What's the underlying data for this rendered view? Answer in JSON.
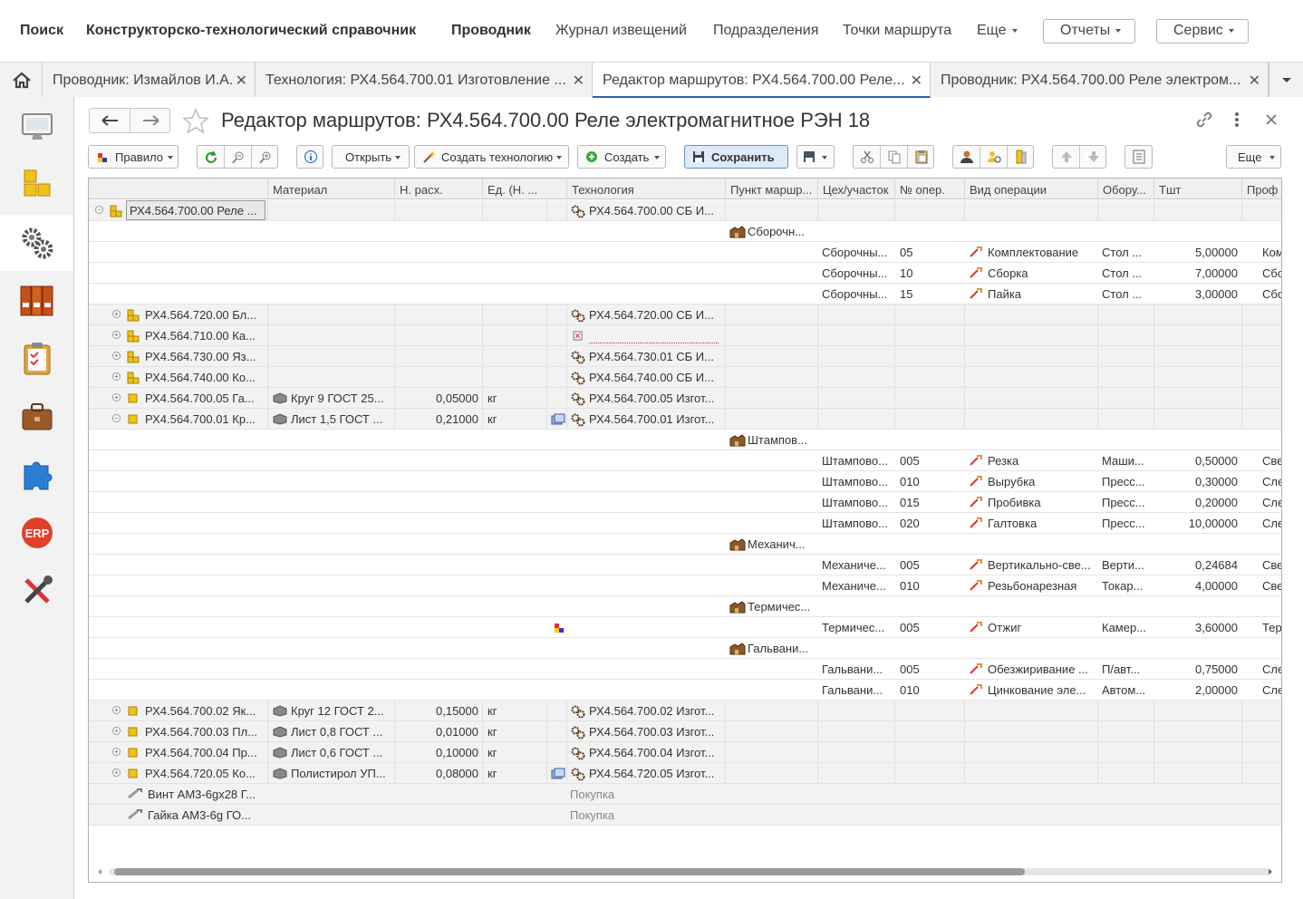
{
  "topnav": {
    "search": "Поиск",
    "reference": "Конструкторско-технологический справочник",
    "explorer": "Проводник",
    "journal": "Журнал извещений",
    "divisions": "Подразделения",
    "route_points": "Точки маршрута",
    "more": "Еще",
    "reports": "Отчеты",
    "service": "Сервис"
  },
  "tabs": [
    {
      "label": "Проводник: Измайлов И.А."
    },
    {
      "label": "Технология: РХ4.564.700.01 Изготовление ..."
    },
    {
      "label": "Редактор маршрутов: РХ4.564.700.00 Реле..."
    },
    {
      "label": "Проводник: РХ4.564.700.00 Реле электром..."
    }
  ],
  "sidebar": [
    "desktop-icon",
    "catalog-icon",
    "settings-icon",
    "folders-icon",
    "tasks-icon",
    "briefcase-icon",
    "puzzle-icon",
    "erp-icon",
    "tools-icon"
  ],
  "sidebar_erp": "ERP",
  "form": {
    "title": "Редактор маршрутов: РХ4.564.700.00 Реле электромагнитное РЭН 18"
  },
  "toolbar": {
    "rule": "Правило",
    "open": "Открыть",
    "create_tech": "Создать технологию",
    "create": "Создать",
    "save": "Сохранить",
    "more": "Еще"
  },
  "columns": [
    "Материал",
    "Н. расх.",
    "Ед. (Н. ...",
    "Технология",
    "Пункт маршр...",
    "Цех/участок",
    "№ опер.",
    "Вид операции",
    "Обору...",
    "Тшт",
    "Проф"
  ],
  "rows": [
    {
      "name": "РХ4.564.700.00 Реле ...",
      "tech": "РХ4.564.700.00 СБ И..."
    },
    {
      "point": "Сборочн..."
    },
    {
      "shop": "Сборочны...",
      "opno": "05",
      "optype": "Комплектование",
      "equip": "Стол ...",
      "tsht": "5,00000",
      "prof": "Компл"
    },
    {
      "shop": "Сборочны...",
      "opno": "10",
      "optype": "Сборка",
      "equip": "Стол ...",
      "tsht": "7,00000",
      "prof": "Сборщ"
    },
    {
      "shop": "Сборочны...",
      "opno": "15",
      "optype": "Пайка",
      "equip": "Стол ...",
      "tsht": "3,00000",
      "prof": "Сборщ"
    },
    {
      "name": "РХ4.564.720.00 Бл...",
      "tech": "РХ4.564.720.00 СБ И..."
    },
    {
      "name": "РХ4.564.710.00 Ка..."
    },
    {
      "name": "РХ4.564.730.00 Яз...",
      "tech": "РХ4.564.730.01 СБ И..."
    },
    {
      "name": "РХ4.564.740.00 Ко...",
      "tech": "РХ4.564.740.00 СБ И..."
    },
    {
      "name": "РХ4.564.700.05 Га...",
      "material": "Круг 9  ГОСТ 25...",
      "norm": "0,05000",
      "unit": "кг",
      "tech": "РХ4.564.700.05 Изгот..."
    },
    {
      "name": "РХ4.564.700.01 Кр...",
      "material": "Лист 1,5  ГОСТ ...",
      "norm": "0,21000",
      "unit": "кг",
      "tech": "РХ4.564.700.01 Изгот..."
    },
    {
      "point": "Штампов..."
    },
    {
      "shop": "Штампово...",
      "opno": "005",
      "optype": "Резка",
      "equip": "Маши...",
      "tsht": "0,50000",
      "prof": "Сверл"
    },
    {
      "shop": "Штампово...",
      "opno": "010",
      "optype": "Вырубка",
      "equip": "Пресс...",
      "tsht": "0,30000",
      "prof": "Слеса"
    },
    {
      "shop": "Штампово...",
      "opno": "015",
      "optype": "Пробивка",
      "equip": "Пресс...",
      "tsht": "0,20000",
      "prof": "Слеса"
    },
    {
      "shop": "Штампово...",
      "opno": "020",
      "optype": "Галтовка",
      "equip": "Пресс...",
      "tsht": "10,00000",
      "prof": "Слеса"
    },
    {
      "point": "Механич..."
    },
    {
      "shop": "Механиче...",
      "opno": "005",
      "optype": "Вертикально-све...",
      "equip": "Верти...",
      "tsht": "0,24684",
      "prof": "Сверл"
    },
    {
      "shop": "Механиче...",
      "opno": "010",
      "optype": "Резьбонарезная",
      "equip": "Токар...",
      "tsht": "4,00000",
      "prof": "Сверл"
    },
    {
      "point": "Термичес..."
    },
    {
      "shop": "Термичес...",
      "opno": "005",
      "optype": "Отжиг",
      "equip": "Камер...",
      "tsht": "3,60000",
      "prof": "Терми"
    },
    {
      "point": "Гальвани..."
    },
    {
      "shop": "Гальвани...",
      "opno": "005",
      "optype": "Обезжиривание ...",
      "equip": "П/авт...",
      "tsht": "0,75000",
      "prof": "Слеса"
    },
    {
      "shop": "Гальвани...",
      "opno": "010",
      "optype": "Цинкование эле...",
      "equip": "Автом...",
      "tsht": "2,00000",
      "prof": "Слеса"
    },
    {
      "name": "РХ4.564.700.02 Як...",
      "material": "Круг 12  ГОСТ 2...",
      "norm": "0,15000",
      "unit": "кг",
      "tech": "РХ4.564.700.02 Изгот..."
    },
    {
      "name": "РХ4.564.700.03 Пл...",
      "material": "Лист 0,8  ГОСТ ...",
      "norm": "0,01000",
      "unit": "кг",
      "tech": "РХ4.564.700.03 Изгот..."
    },
    {
      "name": "РХ4.564.700.04 Пр...",
      "material": "Лист 0,6  ГОСТ ...",
      "norm": "0,10000",
      "unit": "кг",
      "tech": "РХ4.564.700.04 Изгот..."
    },
    {
      "name": "РХ4.564.720.05 Ко...",
      "material": "Полистирол УП...",
      "norm": "0,08000",
      "unit": "кг",
      "tech": "РХ4.564.720.05 Изгот..."
    },
    {
      "name": "Винт АМ3-6gx28 Г...",
      "tech": "Покупка"
    },
    {
      "name": "Гайка АМ3-6g  ГО...",
      "tech": "Покупка"
    }
  ]
}
